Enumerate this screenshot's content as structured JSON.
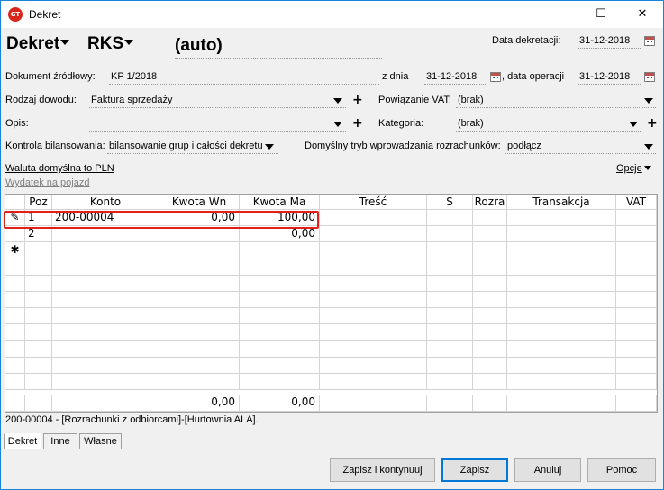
{
  "window": {
    "title": "Dekret",
    "icon_text": "GT",
    "minimize": "—",
    "maximize": "☐",
    "close": "✕"
  },
  "header": {
    "type": "Dekret",
    "register": "RKS",
    "number": "(auto)",
    "decree_date_label": "Data dekretacji:",
    "decree_date": "31-12-2018"
  },
  "form": {
    "source_doc_label": "Dokument źródłowy:",
    "source_doc": "KP 1/2018",
    "from_date_label": "z dnia",
    "from_date": "31-12-2018",
    "op_date_label": ", data operacji",
    "op_date": "31-12-2018",
    "proof_type_label": "Rodzaj dowodu:",
    "proof_type": "Faktura sprzedaży",
    "vat_link_label": "Powiązanie VAT:",
    "vat_link": "(brak)",
    "description_label": "Opis:",
    "description": "",
    "category_label": "Kategoria:",
    "category": "(brak)",
    "balance_control_label": "Kontrola bilansowania:",
    "balance_control": "bilansowanie grup i całości dekretu",
    "settlement_mode_label": "Domyślny tryb wprowadzania rozrachunków:",
    "settlement_mode": "podłącz",
    "currency_link": "Waluta domyślna to PLN",
    "car_expense_link": "Wydatek na pojazd",
    "options": "Opcje"
  },
  "table": {
    "columns": [
      "Poz",
      "Konto",
      "Kwota Wn",
      "Kwota Ma",
      "Treść",
      "S",
      "Rozra",
      "Transakcja",
      "VAT"
    ],
    "rows": [
      {
        "marker": "✎",
        "poz": "1",
        "konto": "200-00004",
        "wn": "0,00",
        "ma": "100,00"
      },
      {
        "marker": "",
        "poz": "2",
        "konto": "",
        "wn": "",
        "ma": "0,00"
      },
      {
        "marker": "✱",
        "poz": "",
        "konto": "",
        "wn": "",
        "ma": ""
      }
    ],
    "totals": {
      "wn": "0,00",
      "ma": "0,00"
    }
  },
  "status_line": "200-00004 - [Rozrachunki z odbiorcami]-[Hurtownia ALA].",
  "tabs": [
    "Dekret",
    "Inne",
    "Własne"
  ],
  "buttons": {
    "save_continue": "Zapisz i kontynuuj",
    "save": "Zapisz",
    "cancel": "Anuluj",
    "help": "Pomoc"
  }
}
